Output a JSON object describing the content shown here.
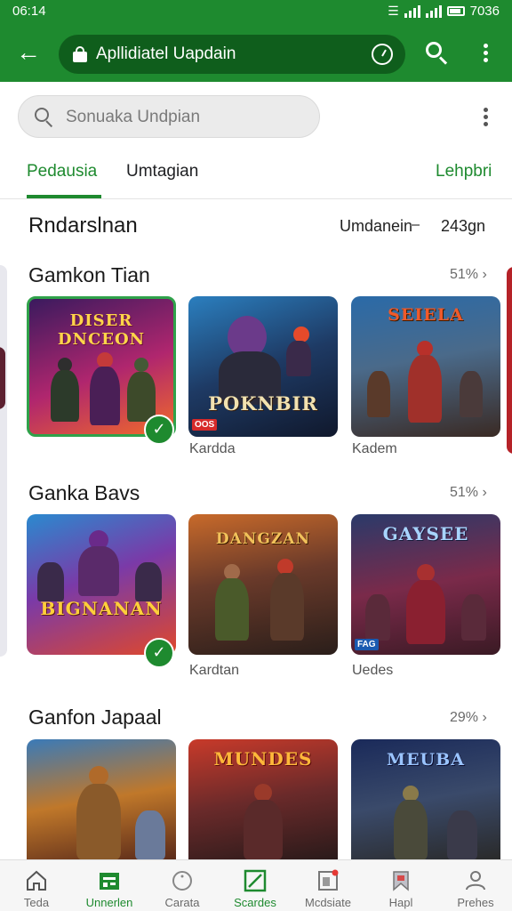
{
  "status": {
    "time": "06:14",
    "battery_text": "7036"
  },
  "appbar": {
    "url": "Apllidiatel Uapdain"
  },
  "search": {
    "placeholder": "Sonuaka Undpian"
  },
  "tabs": [
    {
      "label": "Pedausia",
      "active": true
    },
    {
      "label": "Umtagian",
      "active": false
    },
    {
      "label": "Lehpbri",
      "active": false
    }
  ],
  "summary": {
    "title": "Rndarslnan",
    "label": "Umdanein",
    "value": "243gn"
  },
  "sections": [
    {
      "title": "Gamkon Tian",
      "more": "51%",
      "tiles": [
        {
          "art_title": "DISER DNCEON",
          "caption": ""
        },
        {
          "art_title": "POKNBIR",
          "caption": "Kardda",
          "tag": "OOS"
        },
        {
          "art_title": "SEIELA",
          "caption": "Kadem"
        }
      ]
    },
    {
      "title": "Ganka Bavs",
      "more": "51%",
      "tiles": [
        {
          "art_title": "BIGNANAN",
          "caption": ""
        },
        {
          "art_title": "DANGZAN",
          "caption": "Kardtan"
        },
        {
          "art_title": "GAYSEE",
          "caption": "Uedes",
          "tag": "FAG"
        }
      ]
    },
    {
      "title": "Ganfon Japaal",
      "more": "29%",
      "tiles": [
        {
          "art_title": "",
          "caption": ""
        },
        {
          "art_title": "MUNDES",
          "caption": ""
        },
        {
          "art_title": "MEUBA",
          "caption": ""
        }
      ]
    }
  ],
  "bottom_nav": [
    {
      "label": "Teda",
      "icon": "home-icon"
    },
    {
      "label": "Unnerlen",
      "icon": "store-icon"
    },
    {
      "label": "Carata",
      "icon": "circle-icon"
    },
    {
      "label": "Scardes",
      "icon": "edit-icon"
    },
    {
      "label": "Mcdsiate",
      "icon": "news-icon"
    },
    {
      "label": "Hapl",
      "icon": "bookmark-icon"
    },
    {
      "label": "Prehes",
      "icon": "profile-icon"
    }
  ],
  "colors": {
    "brand_green": "#1e8a2f",
    "urlbar_green": "#0f5e1c"
  }
}
